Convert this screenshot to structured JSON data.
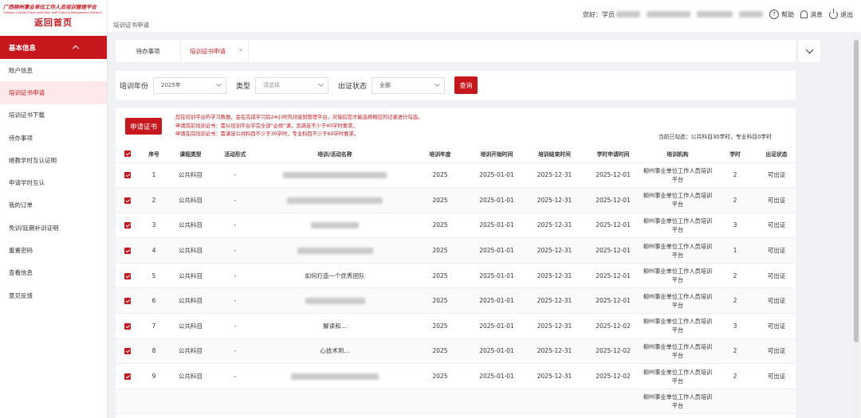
{
  "logo": {
    "title": "广西柳州事业单位工作人员培训管理平台",
    "subtitle": "Guangxi Liuzhou Public Institution Staff Training Management Platform",
    "home": "返回首页"
  },
  "sidebar": {
    "header": "基本信息",
    "items": [
      {
        "label": "账户信息"
      },
      {
        "label": "培训证书申请"
      },
      {
        "label": "培训证书下载"
      },
      {
        "label": "待办事项"
      },
      {
        "label": "继教学时互认证明"
      },
      {
        "label": "申请学时互认"
      },
      {
        "label": "我的订单"
      },
      {
        "label": "免训/延期补训证明"
      },
      {
        "label": "重置密码"
      },
      {
        "label": "查看信息"
      },
      {
        "label": "意见反馈"
      }
    ]
  },
  "header": {
    "breadcrumb": "培训证书申请",
    "greeting": "您好：学员",
    "help_label": "帮助",
    "message_label": "消息",
    "logout_label": "退出"
  },
  "tabs": [
    {
      "label": "待办事项"
    },
    {
      "label": "培训证书申请",
      "close": "×"
    }
  ],
  "filter": {
    "year_label": "培训年份",
    "year_value": "2025年",
    "type_label": "类型",
    "type_placeholder": "请选择",
    "status_label": "出证状态",
    "status_value": "全部",
    "query_button": "查询"
  },
  "apply_button": "申请证书",
  "notice": [
    "您在培训平台的学习数据，会在完成学习后24小时内对接到管理平台，对接后您才能选择相应的记录进行勾选。",
    "申请岗前培训证书：需从培训平台学完全部“必修”课，且满足不少于40学时要求。",
    "申请在岗培训证书：需满足公共科目不少于30学时，专业科目不少于60学时要求。"
  ],
  "selected_info": "当前已勾选：公共科目30学时，专业科目0学时",
  "table": {
    "headers": [
      "序号",
      "课程类型",
      "活动形式",
      "培训/活动名称",
      "培训年度",
      "培训开始时间",
      "培训结束时间",
      "学时申请时间",
      "培训机构",
      "学时",
      "出证状态"
    ],
    "rows": [
      {
        "no": "1",
        "type": "公共科目",
        "form": "-",
        "name": "",
        "year": "2025",
        "start": "2025-01-01",
        "end": "2025-12-31",
        "apply": "2025-12-01",
        "inst": "柳州事业单位工作人员培训平台",
        "hours": "2",
        "status": "可出证"
      },
      {
        "no": "2",
        "type": "公共科目",
        "form": "-",
        "name": "",
        "year": "2025",
        "start": "2025-01-01",
        "end": "2025-12-31",
        "apply": "2025-12-01",
        "inst": "柳州事业单位工作人员培训平台",
        "hours": "2",
        "status": "可出证"
      },
      {
        "no": "3",
        "type": "公共科目",
        "form": "-",
        "name": "",
        "year": "2025",
        "start": "2025-01-01",
        "end": "2025-12-31",
        "apply": "2025-12-01",
        "inst": "柳州事业单位工作人员培训平台",
        "hours": "3",
        "status": "可出证"
      },
      {
        "no": "4",
        "type": "公共科目",
        "form": "-",
        "name": "",
        "year": "2025",
        "start": "2025-01-01",
        "end": "2025-12-31",
        "apply": "2025-12-01",
        "inst": "柳州事业单位工作人员培训平台",
        "hours": "1",
        "status": "可出证"
      },
      {
        "no": "5",
        "type": "公共科目",
        "form": "-",
        "name": "如何打造一个优秀团队",
        "year": "2025",
        "start": "2025-01-01",
        "end": "2025-12-31",
        "apply": "2025-12-01",
        "inst": "柳州事业单位工作人员培训平台",
        "hours": "2",
        "status": "可出证"
      },
      {
        "no": "6",
        "type": "公共科目",
        "form": "-",
        "name": "",
        "year": "2025",
        "start": "2025-01-01",
        "end": "2025-12-31",
        "apply": "2025-12-01",
        "inst": "柳州事业单位工作人员培训平台",
        "hours": "2",
        "status": "可出证"
      },
      {
        "no": "7",
        "type": "公共科目",
        "form": "-",
        "name": "解读和...",
        "year": "2025",
        "start": "2025-01-01",
        "end": "2025-12-31",
        "apply": "2025-12-02",
        "inst": "柳州事业单位工作人员培训平台",
        "hours": "3",
        "status": "可出证"
      },
      {
        "no": "8",
        "type": "公共科目",
        "form": "-",
        "name": "心技术到...",
        "year": "2025",
        "start": "2025-01-01",
        "end": "2025-12-31",
        "apply": "2025-12-02",
        "inst": "柳州事业单位工作人员培训平台",
        "hours": "2",
        "status": "可出证"
      },
      {
        "no": "9",
        "type": "公共科目",
        "form": "-",
        "name": "",
        "year": "2025",
        "start": "2025-01-01",
        "end": "2025-12-31",
        "apply": "2025-12-02",
        "inst": "柳州事业单位工作人员培训平台",
        "hours": "2",
        "status": "可出证"
      },
      {
        "no": "",
        "type": "",
        "form": "",
        "name": "",
        "year": "",
        "start": "",
        "end": "",
        "apply": "",
        "inst": "柳州事业单位工作人员培训平台",
        "hours": "",
        "status": ""
      }
    ]
  },
  "colors": {
    "brand": "#c8161d",
    "sidebar_active_bg": "#fde9ea"
  }
}
